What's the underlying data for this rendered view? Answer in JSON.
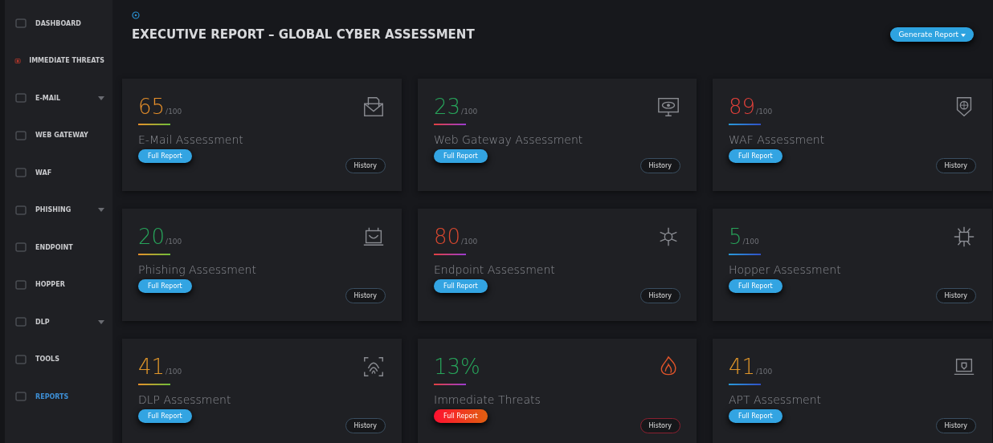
{
  "sidebar": {
    "items": [
      {
        "label": "DASHBOARD",
        "selected": false,
        "expandable": false
      },
      {
        "label": "IMMEDIATE THREATS",
        "selected": false,
        "expandable": false
      },
      {
        "label": "E-MAIL",
        "selected": false,
        "expandable": true
      },
      {
        "label": "WEB GATEWAY",
        "selected": false,
        "expandable": false
      },
      {
        "label": "WAF",
        "selected": false,
        "expandable": false
      },
      {
        "label": "PHISHING",
        "selected": false,
        "expandable": true
      },
      {
        "label": "ENDPOINT",
        "selected": false,
        "expandable": false
      },
      {
        "label": "HOPPER",
        "selected": false,
        "expandable": false
      },
      {
        "label": "DLP",
        "selected": false,
        "expandable": true
      },
      {
        "label": "TOOLS",
        "selected": false,
        "expandable": false
      },
      {
        "label": "REPORTS",
        "selected": true,
        "expandable": false
      }
    ]
  },
  "header": {
    "title": "EXECUTIVE REPORT – GLOBAL CYBER ASSESSMENT",
    "action": "Generate Report"
  },
  "cards": [
    {
      "score": "65",
      "suffix": "/100",
      "color": "#e8902a",
      "title": "E-Mail Assessment",
      "report": "Full Report",
      "kind": "normal",
      "history": "History"
    },
    {
      "score": "23",
      "suffix": "/100",
      "color": "#27a35a",
      "title": "Web Gateway Assessment",
      "report": "Full Report",
      "kind": "normal",
      "history": "History"
    },
    {
      "score": "89",
      "suffix": "/100",
      "color": "#e0403a",
      "title": "WAF Assessment",
      "report": "Full Report",
      "kind": "normal",
      "history": "History"
    },
    {
      "score": "20",
      "suffix": "/100",
      "color": "#27a35a",
      "title": "Phishing Assessment",
      "report": "Full Report",
      "kind": "normal",
      "history": "History"
    },
    {
      "score": "80",
      "suffix": "/100",
      "color": "#d9482f",
      "title": "Endpoint Assessment",
      "report": "Full Report",
      "kind": "normal",
      "history": "History"
    },
    {
      "score": "5",
      "suffix": "/100",
      "color": "#27a35a",
      "title": "Hopper Assessment",
      "report": "Full Report",
      "kind": "normal",
      "history": "History"
    },
    {
      "score": "41",
      "suffix": "/100",
      "color": "#e0962a",
      "title": "DLP Assessment",
      "report": "Full Report",
      "kind": "normal",
      "history": "History"
    },
    {
      "score": "13%",
      "color": "#27a35a",
      "title": "Immediate Threats",
      "report": "Full Report",
      "kind": "alert",
      "history": "History"
    },
    {
      "score": "41",
      "suffix": "/100",
      "color": "#e0962a",
      "title": "APT Assessment",
      "report": "Full Report",
      "kind": "normal",
      "history": "History"
    }
  ]
}
